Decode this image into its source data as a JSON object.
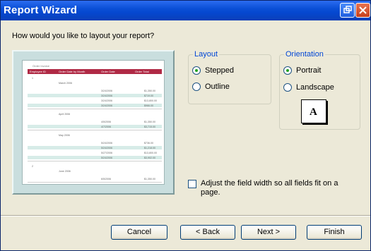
{
  "window": {
    "title": "Report Wizard"
  },
  "prompt": "How would you like to layout your report?",
  "preview": {
    "report_title": "Order Invoice",
    "headers": [
      "Employee ID",
      "Order Date by Month",
      "Order Date",
      "Order Total"
    ],
    "groups": [
      {
        "id": "1",
        "months": [
          {
            "month": "March 2006",
            "rows": [
              [
                "3/24/2006",
                "$1,350.00"
              ],
              [
                "3/24/2006",
                "$719.00"
              ],
              [
                "3/24/2006",
                "$13,800.00"
              ],
              [
                "3/24/2006",
                "$966.00"
              ]
            ]
          },
          {
            "month": "April 2006",
            "rows": [
              [
                "4/5/2006",
                "$1,350.00"
              ],
              [
                "4/7/2006",
                "$3,715.00"
              ]
            ]
          },
          {
            "month": "May 2006",
            "rows": [
              [
                "5/24/2006",
                "$736.00"
              ],
              [
                "5/24/2006",
                "$1,218.00"
              ],
              [
                "5/27/2006",
                "$13,800.00"
              ],
              [
                "5/24/2006",
                "$3,902.00"
              ]
            ]
          }
        ]
      },
      {
        "id": "2",
        "months": [
          {
            "month": "June 2006",
            "rows": [
              [
                "6/5/2006",
                "$1,350.00"
              ]
            ]
          }
        ]
      }
    ]
  },
  "layout": {
    "legend": "Layout",
    "options": [
      {
        "label": "Stepped",
        "selected": true
      },
      {
        "label": "Outline",
        "selected": false
      }
    ]
  },
  "orientation": {
    "legend": "Orientation",
    "options": [
      {
        "label": "Portrait",
        "selected": true
      },
      {
        "label": "Landscape",
        "selected": false
      }
    ],
    "icon_letter": "A"
  },
  "adjust_checkbox": {
    "label": "Adjust the field width so all fields fit on a page.",
    "checked": false
  },
  "buttons": {
    "cancel": "Cancel",
    "back": "< Back",
    "next": "Next >",
    "finish": "Finish"
  }
}
